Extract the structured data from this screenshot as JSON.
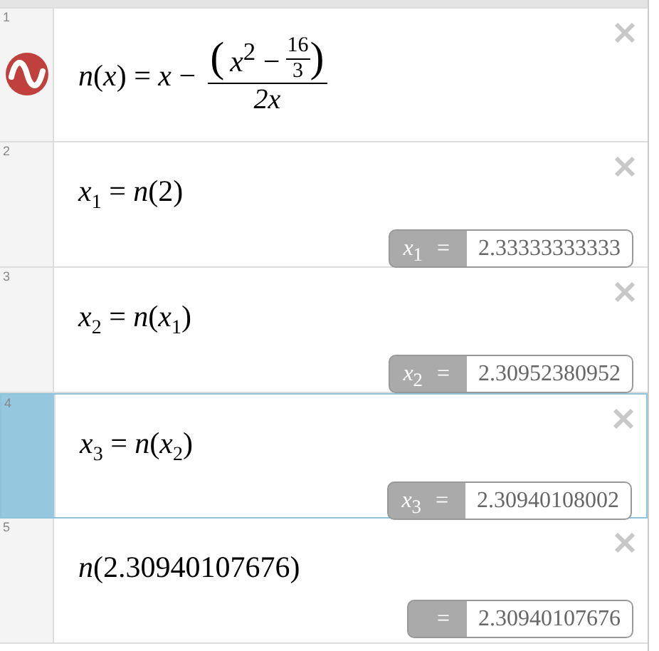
{
  "expressions": [
    {
      "number": "1",
      "kind": "function",
      "selected": false,
      "icon": true,
      "lead": "*n*(*x*) = *x* −",
      "numerator_open": "(",
      "numerator_base": "*x*$^{2}$ −",
      "inner_num": "16",
      "inner_den": "3",
      "numerator_close": ")",
      "denominator": "2x"
    },
    {
      "number": "2",
      "kind": "assignment",
      "selected": false,
      "icon": false,
      "text": "*x*$_{1}$ = *n*(2)",
      "result_label": "*x*$_{1}$ =",
      "result_value": "2.33333333333"
    },
    {
      "number": "3",
      "kind": "assignment",
      "selected": false,
      "icon": false,
      "text": "*x*$_{2}$ = *n*(*x*$_{1}$)",
      "result_label": "*x*$_{2}$ =",
      "result_value": "2.30952380952"
    },
    {
      "number": "4",
      "kind": "assignment",
      "selected": true,
      "icon": false,
      "text": "*x*$_{3}$ = *n*(*x*$_{2}$)",
      "result_label": "*x*$_{3}$ =",
      "result_value": "2.30940108002"
    },
    {
      "number": "5",
      "kind": "assignment",
      "selected": false,
      "icon": false,
      "text": "*n*(2.30940107676)",
      "result_label": "=",
      "result_value": "2.30940107676"
    }
  ]
}
